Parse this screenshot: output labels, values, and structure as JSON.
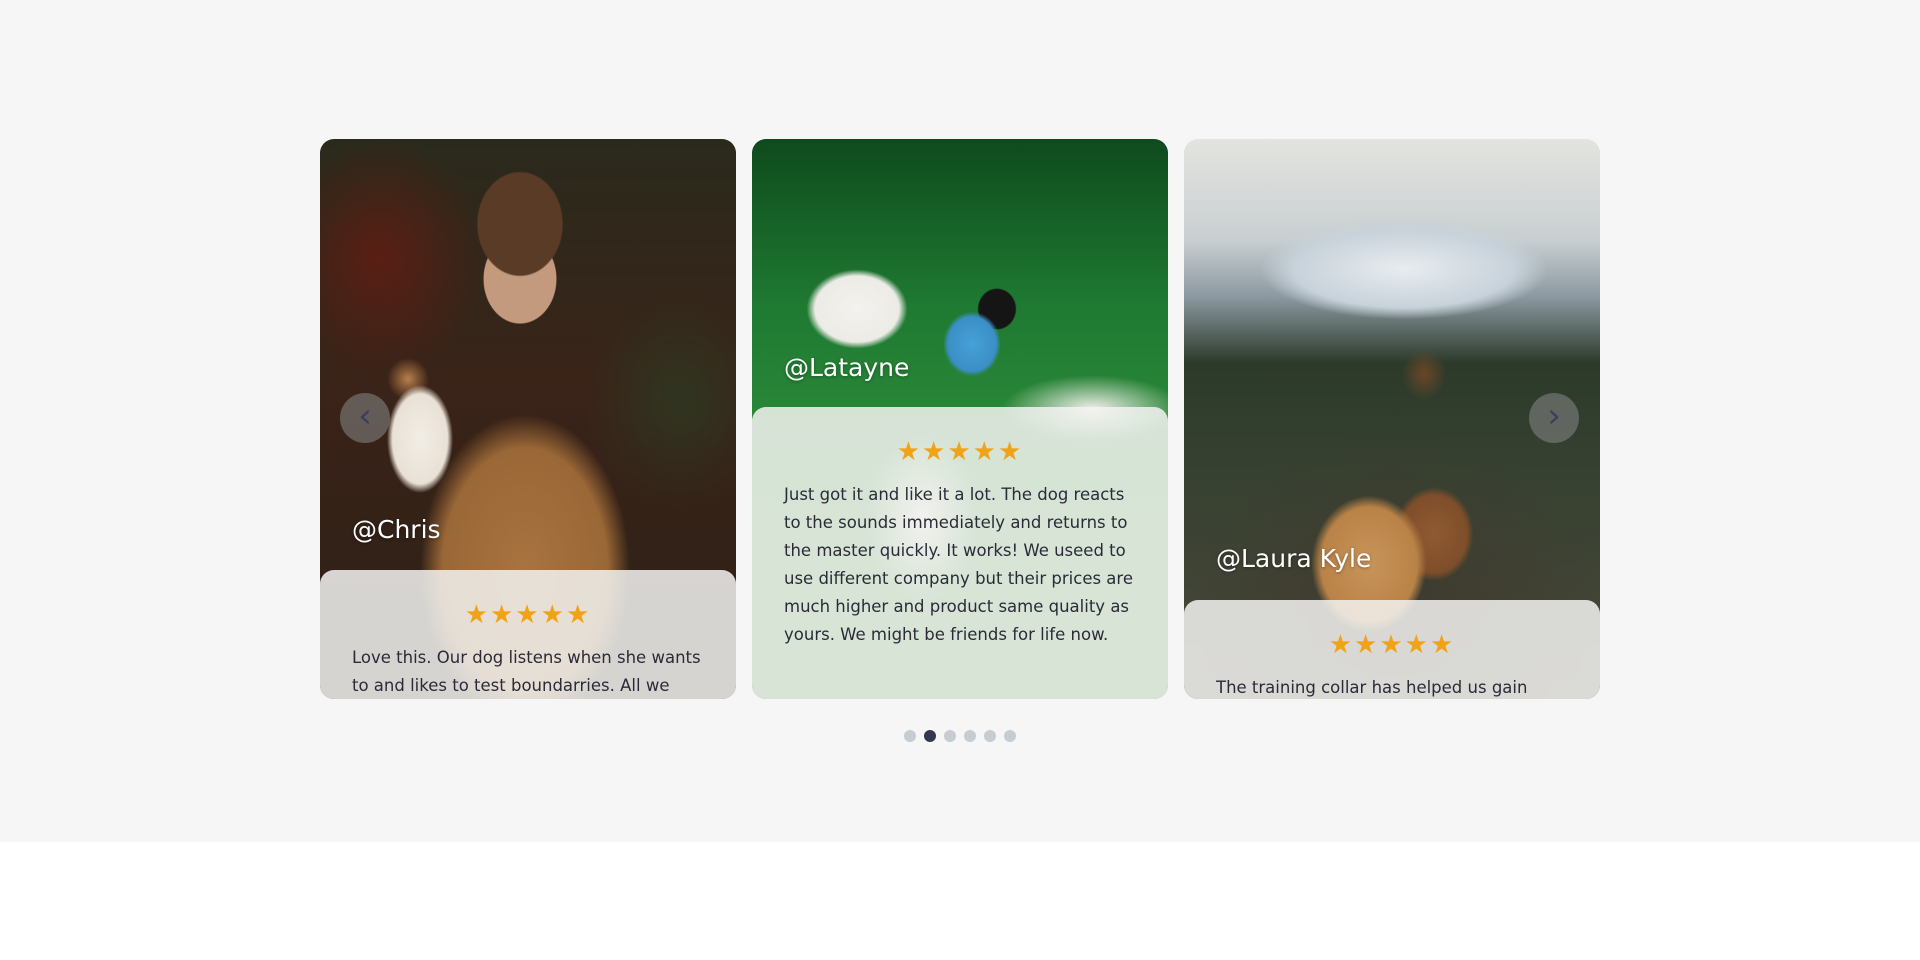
{
  "carousel": {
    "prev_icon": "‹",
    "next_icon": "›",
    "stars": "★★★★★",
    "active_dot": 2,
    "dot_count": 6,
    "cards": [
      {
        "handle": "@Chris",
        "rating": 5,
        "quote": "Love this. Our dog listens when she wants to and likes to test boundarries. All we have"
      },
      {
        "handle": "@Latayne",
        "rating": 5,
        "quote": "Just got it and like it a lot. The dog reacts to the sounds immediately and returns to the master quickly. It works! We useed to use different company but their prices are much higher and product same quality as yours. We might be friends for life now."
      },
      {
        "handle": "@Laura Kyle",
        "rating": 5,
        "quote": "The training collar has helped us gain"
      }
    ]
  },
  "colors": {
    "section_bg": "#f6f6f6",
    "star": "#f0a316",
    "dot_active": "#33374f",
    "dot_inactive": "#c7ccd1"
  }
}
